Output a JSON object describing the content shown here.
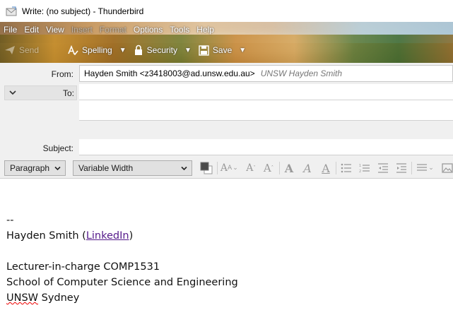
{
  "window": {
    "title": "Write: (no subject) - Thunderbird",
    "app_icon": "compose-envelope-icon"
  },
  "menubar": {
    "items": [
      {
        "label": "File",
        "enabled": true
      },
      {
        "label": "Edit",
        "enabled": true
      },
      {
        "label": "View",
        "enabled": true
      },
      {
        "label": "Insert",
        "enabled": false
      },
      {
        "label": "Format",
        "enabled": false
      },
      {
        "label": "Options",
        "enabled": true
      },
      {
        "label": "Tools",
        "enabled": true
      },
      {
        "label": "Help",
        "enabled": true
      }
    ]
  },
  "toolbar": {
    "send_label": "Send",
    "spelling_label": "Spelling",
    "security_label": "Security",
    "save_label": "Save"
  },
  "headers": {
    "from_label": "From:",
    "from_address": "Hayden Smith <z3418003@ad.unsw.edu.au>",
    "from_identity": "UNSW Hayden Smith",
    "to_label": "To:",
    "to_value": "",
    "subject_label": "Subject:",
    "subject_value": ""
  },
  "format_toolbar": {
    "paragraph_select": "Paragraph",
    "font_select": "Variable Width",
    "text_color": "#4a4a4a",
    "bg_color": "#ffffff"
  },
  "body": {
    "separator": "--",
    "name": "Hayden Smith",
    "link_open": " (",
    "link_text": "LinkedIn",
    "link_close": ")",
    "role": "Lecturer-in-charge COMP1531",
    "school": "School of Computer Science and Engineering",
    "org_word1": "UNSW",
    "org_word2": " Sydney"
  }
}
